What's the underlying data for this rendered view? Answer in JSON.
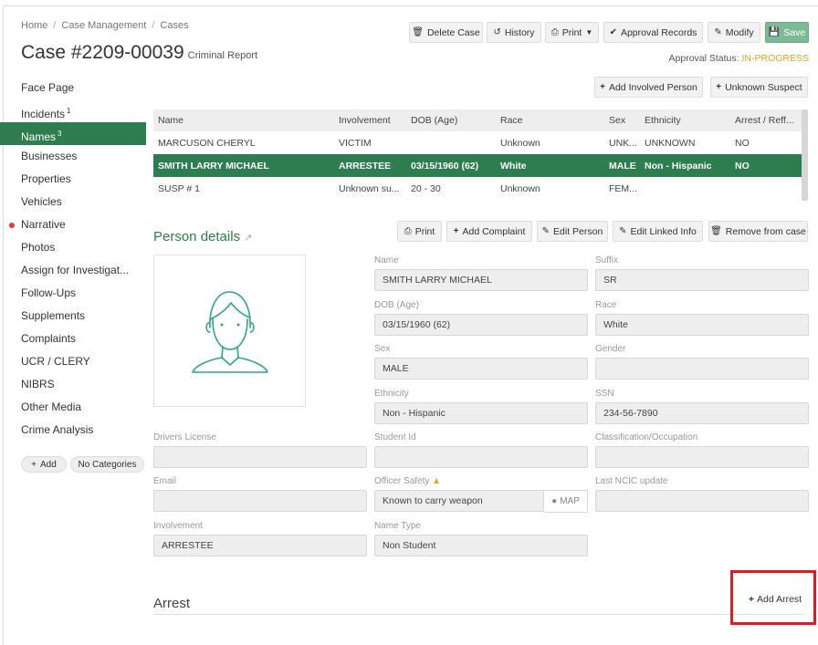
{
  "breadcrumb": [
    "Home",
    "Case Management",
    "Cases"
  ],
  "case": {
    "title": "Case #2209-00039",
    "subtitle": "Criminal Report"
  },
  "toolbar": {
    "delete": "Delete Case",
    "history": "History",
    "print": "Print",
    "approval_records": "Approval Records",
    "modify": "Modify",
    "save": "Save"
  },
  "approval": {
    "label": "Approval Status:",
    "value": "IN-PROGRESS",
    "color": "#f0a020"
  },
  "sidebar": {
    "items": [
      {
        "label": "Face Page"
      },
      {
        "label": "Incidents",
        "count": "1"
      },
      {
        "label": "Names",
        "count": "3"
      },
      {
        "label": "Businesses"
      },
      {
        "label": "Properties"
      },
      {
        "label": "Vehicles"
      },
      {
        "label": "Narrative"
      },
      {
        "label": "Photos"
      },
      {
        "label": "Assign for Investigat..."
      },
      {
        "label": "Follow-Ups"
      },
      {
        "label": "Supplements"
      },
      {
        "label": "Complaints"
      },
      {
        "label": "UCR / CLERY"
      },
      {
        "label": "NIBRS"
      },
      {
        "label": "Other Media"
      },
      {
        "label": "Crime Analysis"
      }
    ],
    "add": "Add",
    "no_categories": "No Categories"
  },
  "names_actions": {
    "add_involved": "Add Involved Person",
    "unknown_suspect": "Unknown Suspect"
  },
  "names_table": {
    "columns": [
      "Name",
      "Involvement",
      "DOB (Age)",
      "Race",
      "Sex",
      "Ethnicity",
      "Arrest / Reff..."
    ],
    "rows": [
      [
        "MARCUSON CHERYL",
        "VICTIM",
        "",
        "Unknown",
        "UNK...",
        "UNKNOWN",
        "NO"
      ],
      [
        "SMITH LARRY MICHAEL",
        "ARRESTEE",
        "03/15/1960 (62)",
        "White",
        "MALE",
        "Non - Hispanic",
        "NO"
      ],
      [
        "SUSP # 1",
        "Unknown su...",
        "20 - 30",
        "Unknown",
        "FEM...",
        "",
        ""
      ]
    ]
  },
  "person": {
    "title": "Person details",
    "actions": {
      "print": "Print",
      "add_complaint": "Add Complaint",
      "edit_person": "Edit Person",
      "edit_linked": "Edit Linked Info",
      "remove": "Remove from case"
    },
    "fields": {
      "name_label": "Name",
      "name": "SMITH LARRY MICHAEL",
      "suffix_label": "Suffix",
      "suffix": "SR",
      "dob_label": "DOB (Age)",
      "dob": "03/15/1960 (62)",
      "race_label": "Race",
      "race": "White",
      "sex_label": "Sex",
      "sex": "MALE",
      "gender_label": "Gender",
      "gender": "",
      "ethnicity_label": "Ethnicity",
      "ethnicity": "Non - Hispanic",
      "ssn_label": "SSN",
      "ssn": "234-56-7890",
      "dl_label": "Drivers License",
      "dl": "",
      "student_label": "Student Id",
      "student": "",
      "class_label": "Classification/Occupation",
      "class": "",
      "email_label": "Email",
      "email": "",
      "officer_label": "Officer Safety",
      "officer": "Known to carry weapon",
      "map": "MAP",
      "ncic_label": "Last NCIC update",
      "ncic": "",
      "involvement_label": "Involvement",
      "involvement": "ARRESTEE",
      "nametype_label": "Name Type",
      "nametype": "Non Student"
    }
  },
  "arrest": {
    "title": "Arrest",
    "add": "Add Arrest"
  },
  "colors": {
    "primary_green": "#2e7d4f",
    "save_green": "#7cba94",
    "highlight_red": "#e01b1b"
  }
}
